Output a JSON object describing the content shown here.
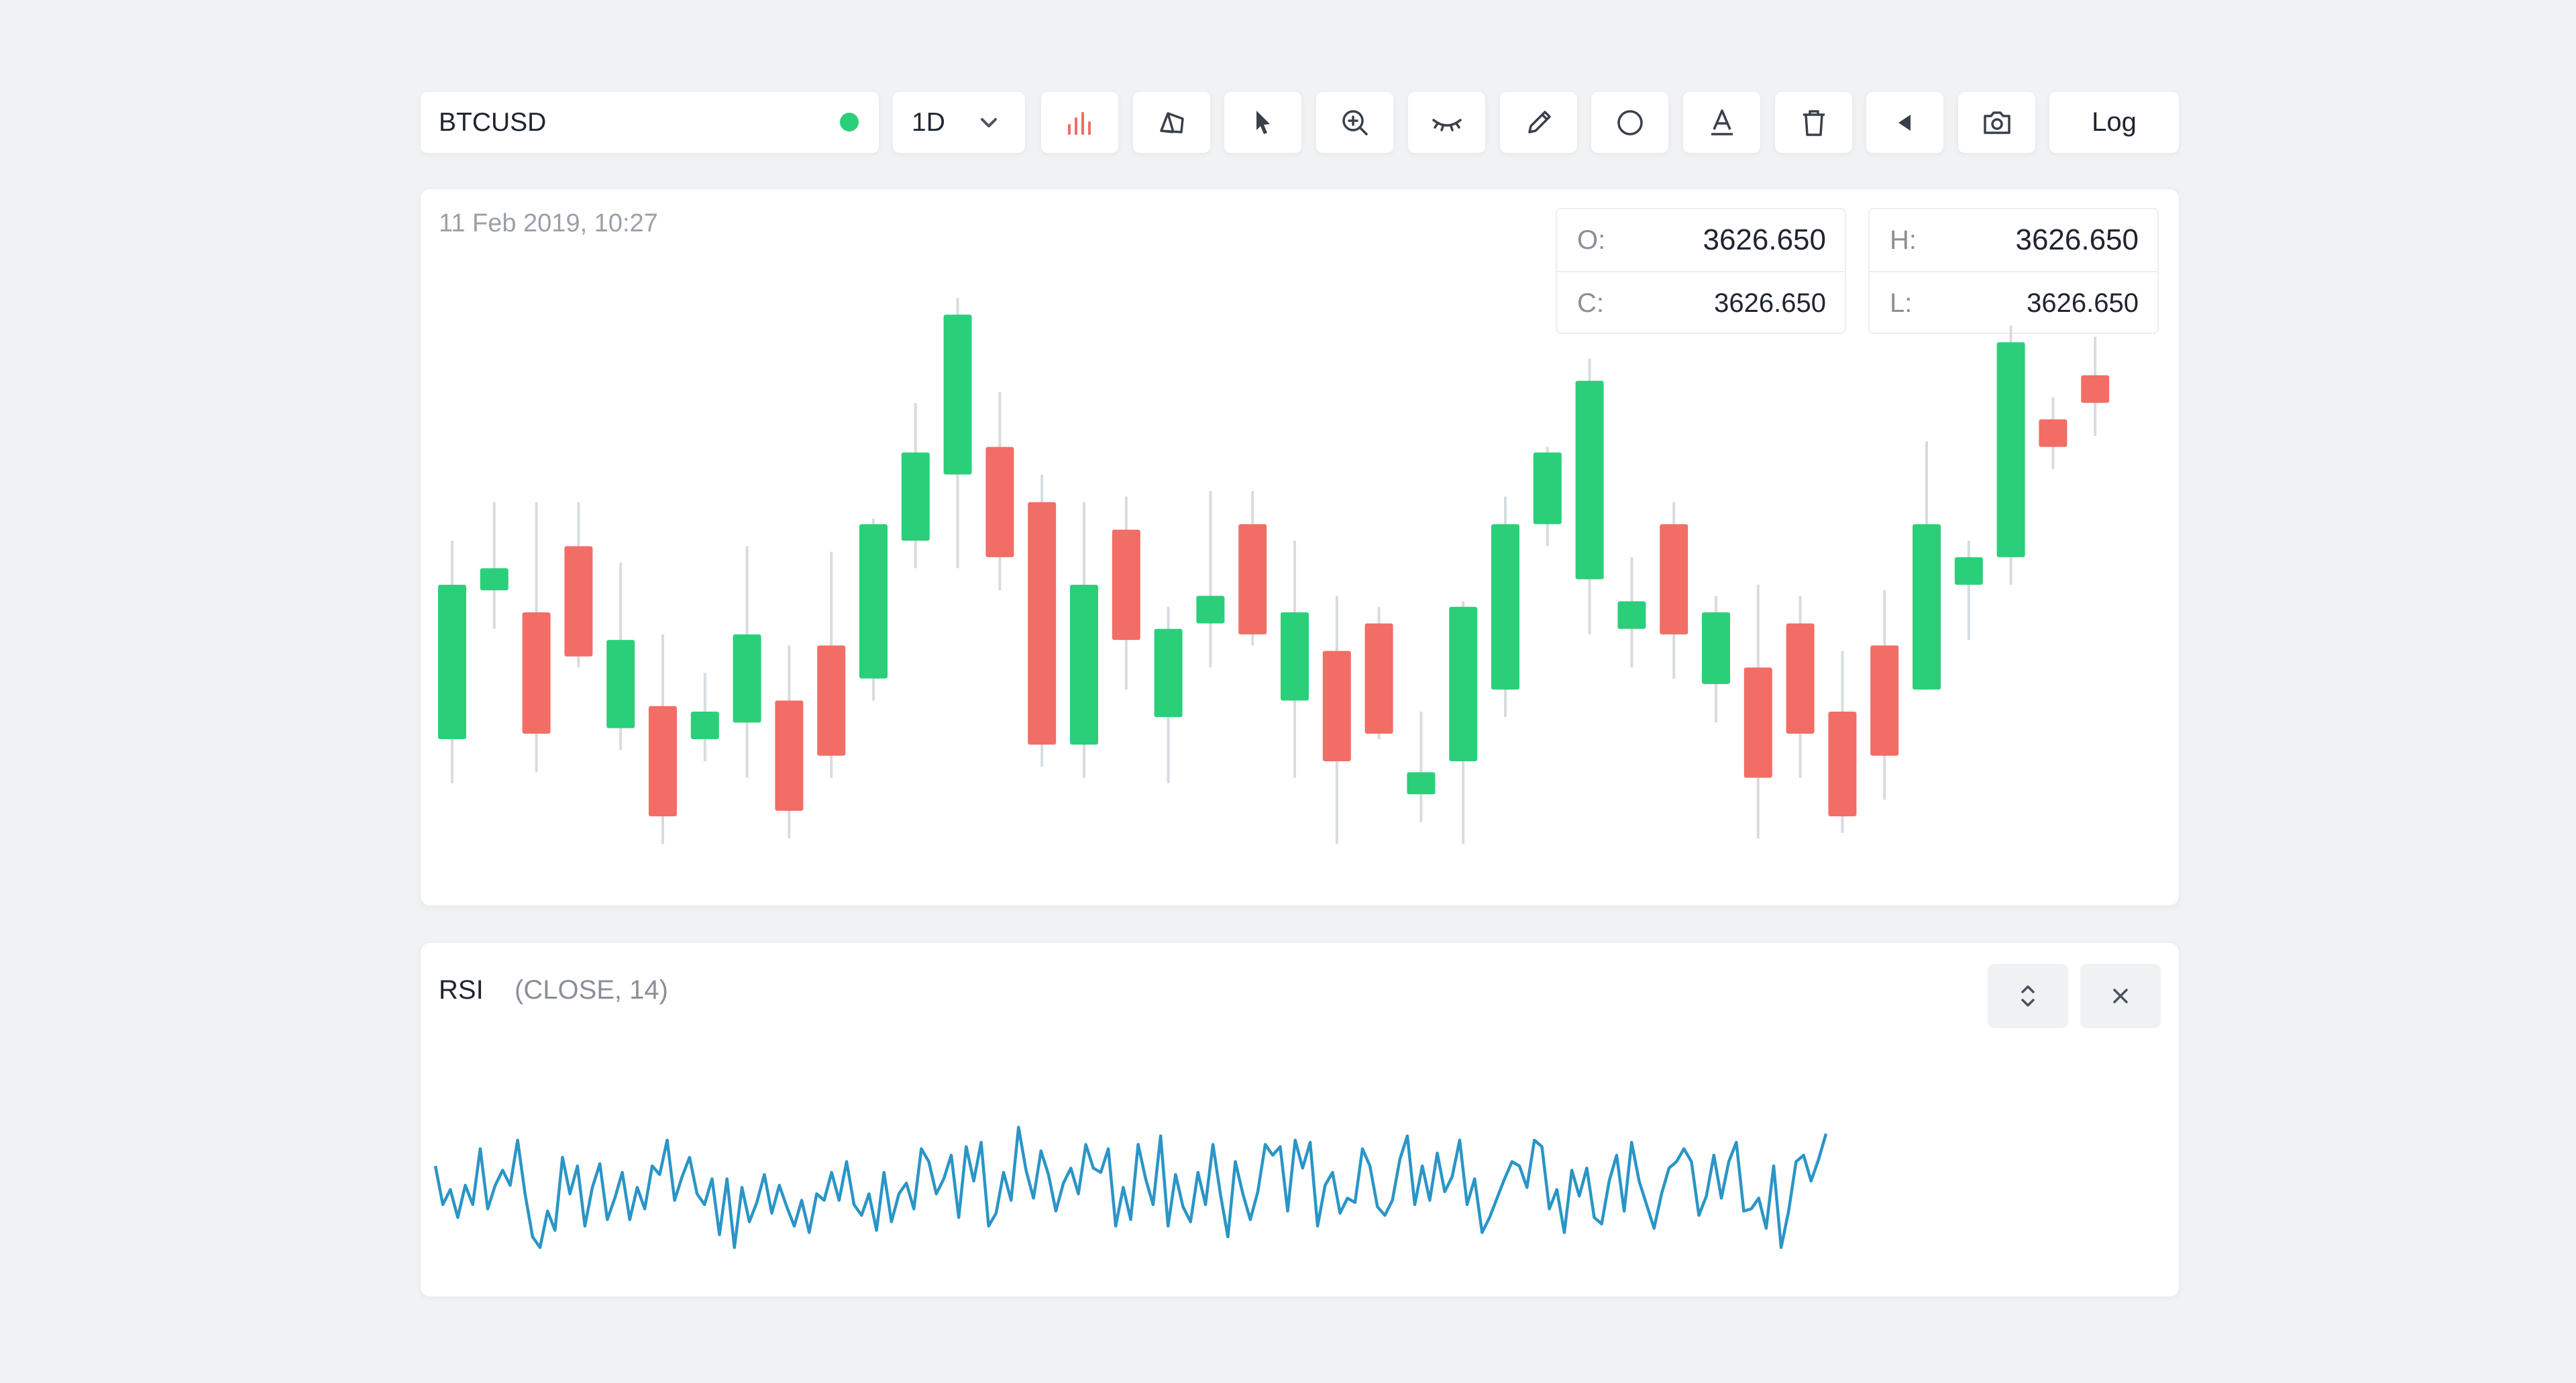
{
  "toolbar": {
    "symbol": "BTCUSD",
    "timeframe": "1D",
    "scale_button": "Log",
    "live_color": "#2bcf7a",
    "tools": [
      "bar-chart-icon",
      "shapes-icon",
      "cursor-icon",
      "zoom-in-icon",
      "hide-drawings-icon",
      "pencil-icon",
      "circle-icon",
      "text-icon",
      "trash-icon",
      "collapse-left-icon",
      "camera-icon"
    ]
  },
  "chart": {
    "timestamp": "11 Feb 2019, 10:27",
    "ohlc": {
      "open_label": "O:",
      "open": "3626.650",
      "high_label": "H:",
      "high": "3626.650",
      "close_label": "C:",
      "close": "3626.650",
      "low_label": "L:",
      "low": "3626.650"
    },
    "colors": {
      "up": "#2bcf7a",
      "down": "#f26d66",
      "wick": "#d8dbe0",
      "rsi": "#2a95c6"
    }
  },
  "chart_data": [
    {
      "type": "candlestick",
      "title": "",
      "ylim": [
        0,
        100
      ],
      "candles": [
        {
          "o": 27,
          "h": 63,
          "l": 19,
          "c": 55
        },
        {
          "o": 54,
          "h": 70,
          "l": 47,
          "c": 58
        },
        {
          "o": 50,
          "h": 70,
          "l": 21,
          "c": 28
        },
        {
          "o": 62,
          "h": 70,
          "l": 40,
          "c": 42
        },
        {
          "o": 29,
          "h": 59,
          "l": 25,
          "c": 45
        },
        {
          "o": 33,
          "h": 46,
          "l": 8,
          "c": 13
        },
        {
          "o": 27,
          "h": 39,
          "l": 23,
          "c": 32
        },
        {
          "o": 30,
          "h": 62,
          "l": 20,
          "c": 46
        },
        {
          "o": 34,
          "h": 44,
          "l": 9,
          "c": 14
        },
        {
          "o": 44,
          "h": 61,
          "l": 20,
          "c": 24
        },
        {
          "o": 38,
          "h": 67,
          "l": 34,
          "c": 66
        },
        {
          "o": 63,
          "h": 88,
          "l": 58,
          "c": 79
        },
        {
          "o": 75,
          "h": 107,
          "l": 58,
          "c": 104
        },
        {
          "o": 80,
          "h": 90,
          "l": 54,
          "c": 60
        },
        {
          "o": 70,
          "h": 75,
          "l": 22,
          "c": 26
        },
        {
          "o": 26,
          "h": 70,
          "l": 20,
          "c": 55
        },
        {
          "o": 65,
          "h": 71,
          "l": 36,
          "c": 45
        },
        {
          "o": 31,
          "h": 51,
          "l": 19,
          "c": 47
        },
        {
          "o": 48,
          "h": 72,
          "l": 40,
          "c": 53
        },
        {
          "o": 66,
          "h": 72,
          "l": 44,
          "c": 46
        },
        {
          "o": 34,
          "h": 63,
          "l": 20,
          "c": 50
        },
        {
          "o": 43,
          "h": 53,
          "l": 8,
          "c": 23
        },
        {
          "o": 48,
          "h": 51,
          "l": 27,
          "c": 28
        },
        {
          "o": 17,
          "h": 32,
          "l": 12,
          "c": 21
        },
        {
          "o": 23,
          "h": 52,
          "l": 8,
          "c": 51
        },
        {
          "o": 36,
          "h": 71,
          "l": 31,
          "c": 66
        },
        {
          "o": 66,
          "h": 80,
          "l": 62,
          "c": 79
        },
        {
          "o": 56,
          "h": 96,
          "l": 46,
          "c": 92
        },
        {
          "o": 47,
          "h": 60,
          "l": 40,
          "c": 52
        },
        {
          "o": 66,
          "h": 70,
          "l": 38,
          "c": 46
        },
        {
          "o": 37,
          "h": 53,
          "l": 30,
          "c": 50
        },
        {
          "o": 40,
          "h": 55,
          "l": 9,
          "c": 20
        },
        {
          "o": 48,
          "h": 53,
          "l": 20,
          "c": 28
        },
        {
          "o": 32,
          "h": 43,
          "l": 10,
          "c": 13
        },
        {
          "o": 44,
          "h": 54,
          "l": 16,
          "c": 24
        },
        {
          "o": 36,
          "h": 81,
          "l": 36,
          "c": 66
        },
        {
          "o": 55,
          "h": 63,
          "l": 45,
          "c": 60
        },
        {
          "o": 60,
          "h": 102,
          "l": 55,
          "c": 99
        },
        {
          "o": 85,
          "h": 89,
          "l": 76,
          "c": 80
        },
        {
          "o": 93,
          "h": 100,
          "l": 82,
          "c": 88
        }
      ]
    },
    {
      "type": "line",
      "title": "RSI",
      "subtitle": "(CLOSE, 14)",
      "ylim": [
        0,
        100
      ],
      "series": [
        {
          "values": [
            58,
            40,
            47,
            34,
            49,
            40,
            66,
            38,
            49,
            56,
            49,
            70,
            45,
            25,
            20,
            37,
            28,
            62,
            45,
            58,
            30,
            48,
            59,
            33,
            43,
            55,
            33,
            48,
            38,
            58,
            54,
            70,
            42,
            53,
            62,
            45,
            40,
            52,
            26,
            52,
            20,
            48,
            32,
            41,
            54,
            36,
            49,
            39,
            30,
            42,
            27,
            45,
            42,
            55,
            42,
            60,
            40,
            35,
            45,
            28,
            55,
            32,
            45,
            50,
            38,
            66,
            60,
            45,
            52,
            63,
            34,
            67,
            51,
            69,
            30,
            36,
            55,
            42,
            76,
            56,
            43,
            65,
            54,
            37,
            50,
            57,
            45,
            68,
            57,
            55,
            66,
            30,
            48,
            33,
            68,
            52,
            40,
            72,
            30,
            54,
            39,
            32,
            55,
            40,
            68,
            45,
            25,
            60,
            45,
            33,
            46,
            68,
            63,
            67,
            37,
            70,
            57,
            69,
            30,
            49,
            55,
            36,
            43,
            41,
            66,
            58,
            39,
            35,
            42,
            61,
            72,
            40,
            58,
            42,
            64,
            46,
            53,
            70,
            40,
            52,
            27,
            34,
            43,
            52,
            60,
            58,
            48,
            70,
            67,
            38,
            47,
            27,
            56,
            44,
            57,
            34,
            31,
            51,
            63,
            37,
            69,
            51,
            40,
            29,
            45,
            57,
            60,
            66,
            60,
            35,
            44,
            63,
            43,
            60,
            69,
            37,
            38,
            43,
            29,
            58,
            20,
            37,
            60,
            63,
            51,
            61,
            73
          ]
        }
      ]
    }
  ],
  "rsi": {
    "title": "RSI",
    "params": "(CLOSE, 14)",
    "buttons": [
      "expand-collapse-icon",
      "close-icon"
    ]
  }
}
